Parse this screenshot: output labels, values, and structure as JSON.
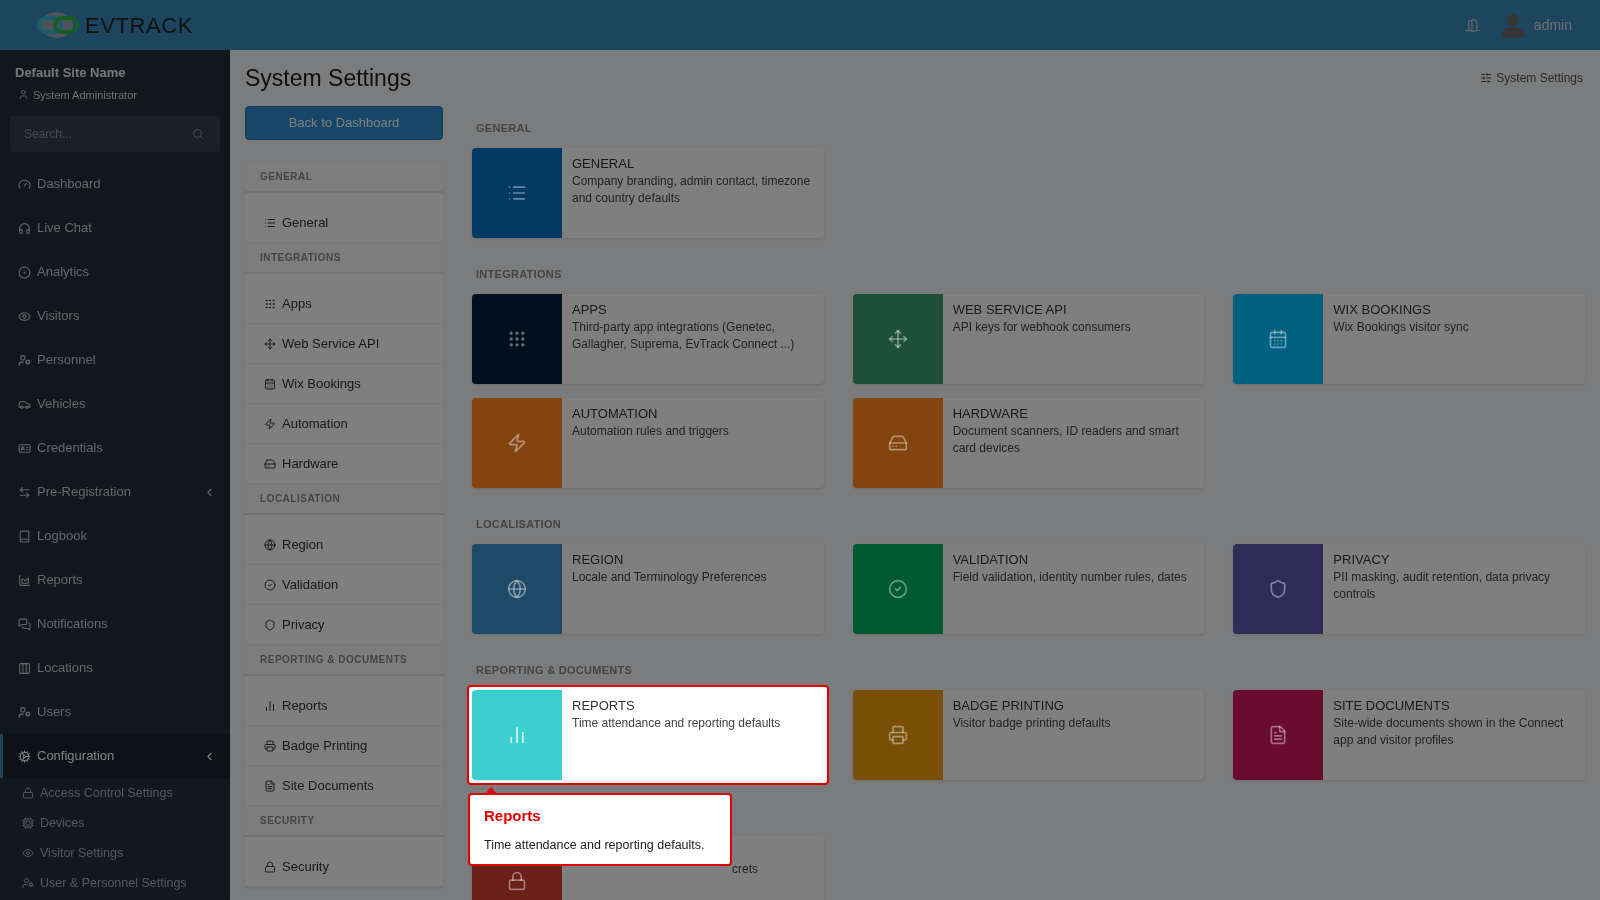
{
  "topbar": {
    "logo": "**EV**TRACK",
    "user": "admin"
  },
  "sidebar": {
    "site_name": "Default Site Name",
    "role": "System Administrator",
    "search": {
      "placeholder": "Search..."
    },
    "items": [
      {
        "label": "Dashboard",
        "selected": false,
        "has_submenu": false
      },
      {
        "label": "Live Chat",
        "selected": false,
        "has_submenu": false
      },
      {
        "label": "Analytics",
        "selected": false,
        "has_submenu": false
      },
      {
        "label": "Visitors",
        "selected": false,
        "has_submenu": false
      },
      {
        "label": "Personnel",
        "selected": false,
        "has_submenu": false
      },
      {
        "label": "Vehicles",
        "selected": false,
        "has_submenu": false
      },
      {
        "label": "Credentials",
        "selected": false,
        "has_submenu": false
      },
      {
        "label": "Pre-Registration",
        "selected": false,
        "has_submenu": true
      },
      {
        "label": "Logbook",
        "selected": false,
        "has_submenu": false
      },
      {
        "label": "Reports",
        "selected": false,
        "has_submenu": false
      },
      {
        "label": "Notifications",
        "selected": false,
        "has_submenu": false
      },
      {
        "label": "Locations",
        "selected": false,
        "has_submenu": false
      },
      {
        "label": "Users",
        "selected": false,
        "has_submenu": false
      },
      {
        "label": "Configuration",
        "selected": true,
        "has_submenu": true,
        "children": [
          "Access Control Settings",
          "Devices",
          "Visitor Settings",
          "User & Personnel Settings"
        ]
      }
    ]
  },
  "page": {
    "title": "System Settings",
    "breadcrumb": "System Settings",
    "back_button": "Back to Dashboard",
    "nav": [
      {
        "heading": "GENERAL",
        "items": [
          "General"
        ]
      },
      {
        "heading": "INTEGRATIONS",
        "items": [
          "Apps",
          "Web Service API",
          "Wix Bookings",
          "Automation",
          "Hardware"
        ]
      },
      {
        "heading": "LOCALISATION",
        "items": [
          "Region",
          "Validation",
          "Privacy"
        ]
      },
      {
        "heading": "REPORTING & DOCUMENTS",
        "items": [
          "Reports",
          "Badge Printing",
          "Site Documents"
        ]
      },
      {
        "heading": "SECURITY",
        "items": [
          "Security"
        ]
      }
    ],
    "groups": [
      {
        "heading": "GENERAL",
        "cards": [
          {
            "title": "GENERAL",
            "description": "Company branding, admin contact, timezone and country defaults",
            "color": "#003a63",
            "highlighted": false
          }
        ]
      },
      {
        "heading": "INTEGRATIONS",
        "cards": [
          {
            "title": "APPS",
            "description": "Third-party app integrations (Genetec, Gallagher, Suprema, EvTrack Connect ...)",
            "color": "#00101f",
            "highlighted": false
          },
          {
            "title": "WEB SERVICE API",
            "description": "API keys for webhook consumers",
            "color": "#1e5038",
            "highlighted": false
          },
          {
            "title": "WIX BOOKINGS",
            "description": "Wix Bookings visitor sync",
            "color": "#006080",
            "highlighted": false
          },
          {
            "title": "AUTOMATION",
            "description": "Automation rules and triggers",
            "color": "#84440f",
            "highlighted": false
          },
          {
            "title": "HARDWARE",
            "description": "Document scanners, ID readers and smart card devices",
            "color": "#84440f",
            "highlighted": false
          }
        ]
      },
      {
        "heading": "LOCALISATION",
        "cards": [
          {
            "title": "REGION",
            "description": "Locale and Terminology Preferences",
            "color": "#1f4a67",
            "highlighted": false
          },
          {
            "title": "VALIDATION",
            "description": "Field validation, identity number rules, dates",
            "color": "#005a30",
            "highlighted": false
          },
          {
            "title": "PRIVACY",
            "description": "PII masking, audit retention, data privacy controls",
            "color": "#302c58",
            "highlighted": false
          }
        ]
      },
      {
        "heading": "REPORTING & DOCUMENTS",
        "cards": [
          {
            "title": "REPORTS",
            "description": "Time attendance and reporting defaults",
            "color": "#3ccfd0",
            "highlighted": true
          },
          {
            "title": "BADGE PRINTING",
            "description": "Visitor badge printing defaults",
            "color": "#7a5008",
            "highlighted": false
          },
          {
            "title": "SITE DOCUMENTS",
            "description": "Site-wide documents shown in the Connect app and visitor profiles",
            "color": "#6a0c30",
            "highlighted": false
          }
        ]
      },
      {
        "cards": [
          {
            "description": "crets",
            "color": "#6a2018",
            "highlighted": false
          }
        ]
      }
    ]
  },
  "tour": {
    "title": "Reports",
    "text": "Time attendance and reporting defaults."
  }
}
